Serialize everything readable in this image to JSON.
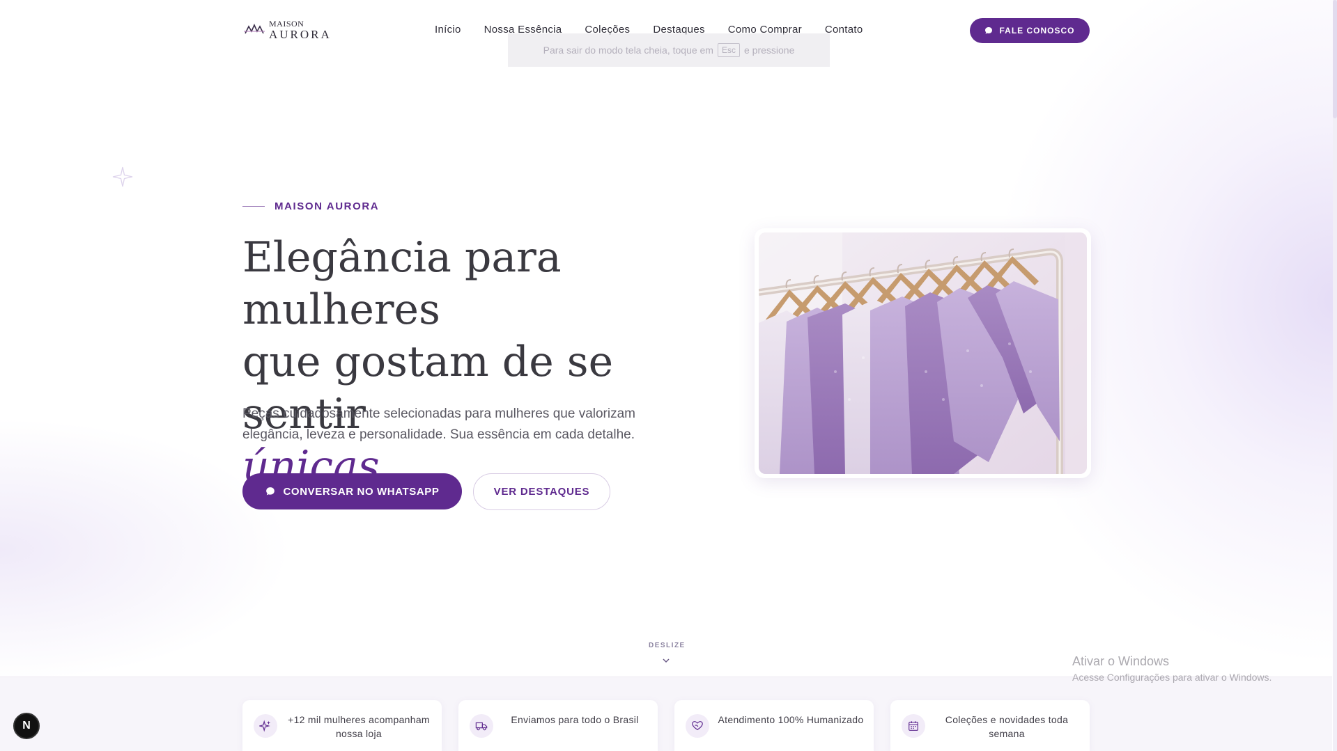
{
  "brand": {
    "logo_top": "MAISON",
    "logo_bottom": "AURORA"
  },
  "nav": {
    "items": [
      "Início",
      "Nossa Essência",
      "Coleções",
      "Destaques",
      "Como Comprar",
      "Contato"
    ],
    "cta_label": "FALE CONOSCO"
  },
  "overlay": {
    "fullscreen_hint_before": "Para sair do modo tela cheia, toque em",
    "fullscreen_key": "Esc",
    "fullscreen_hint_after": "e pressione"
  },
  "hero": {
    "eyebrow": "MAISON AURORA",
    "title_line1": "Elegância para mulheres",
    "title_line2": "que gostam de se sentir",
    "title_accent": "únicas",
    "title_end": ".",
    "description": "Peças cuidadosamente selecionadas para mulheres que valorizam elegância, leveza e personalidade. Sua essência em cada detalhe.",
    "primary_cta": "CONVERSAR NO WHATSAPP",
    "secondary_cta": "VER DESTAQUES"
  },
  "scroll_hint": "DESLIZE",
  "features": [
    {
      "icon": "sparkles-icon",
      "text": "+12 mil mulheres acompanham nossa loja"
    },
    {
      "icon": "truck-icon",
      "text": "Enviamos para todo o Brasil"
    },
    {
      "icon": "heart-hand-icon",
      "text": "Atendimento 100% Humanizado"
    },
    {
      "icon": "calendar-icon",
      "text": "Coleções e novidades toda semana"
    }
  ],
  "windows_watermark": {
    "title": "Ativar o Windows",
    "subtitle": "Acesse Configurações para ativar o Windows."
  },
  "dev_badge": "N",
  "colors": {
    "accent": "#5f2a8f",
    "text": "#3a3940",
    "band": "#f7f5fa"
  }
}
